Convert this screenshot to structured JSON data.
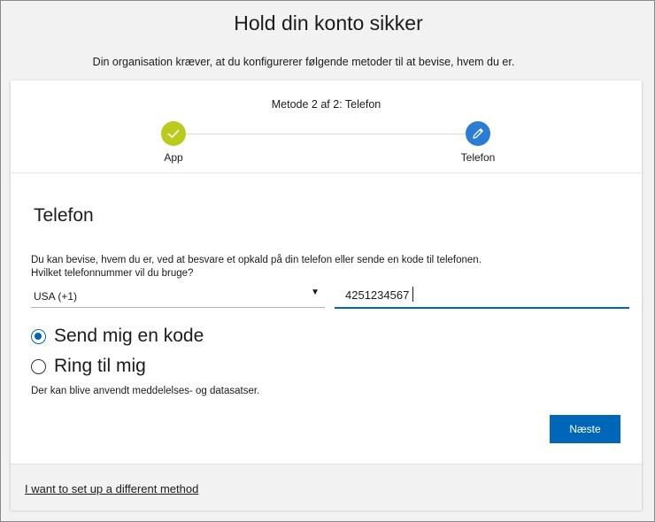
{
  "header": {
    "title": "Hold din konto sikker",
    "subtitle": "Din organisation kræver, at du konfigurerer følgende metoder til at bevise, hvem du er."
  },
  "progress": {
    "step_label": "Metode 2 af 2: Telefon",
    "steps": [
      {
        "name": "App",
        "status": "done"
      },
      {
        "name": "Telefon",
        "status": "current"
      }
    ]
  },
  "phone_setup": {
    "heading": "Telefon",
    "description_line1": "Du kan bevise, hvem du er, ved at besvare et opkald på din telefon eller sende en kode til telefonen.",
    "description_line2": "Hvilket telefonnummer vil du bruge?",
    "country_value": "USA (+1)",
    "phone_value": "4251234567",
    "options": [
      {
        "label": "Send mig en kode",
        "selected": true
      },
      {
        "label": "Ring til mig",
        "selected": false
      }
    ],
    "rates_note": "Der kan blive anvendt meddelelses- og datasatser.",
    "next_label": "Næste"
  },
  "footer": {
    "link_text": "I want to set up a different method"
  },
  "colors": {
    "accent": "#0067b8",
    "done_step": "#b9cc1d",
    "current_step": "#2b7cd3"
  }
}
